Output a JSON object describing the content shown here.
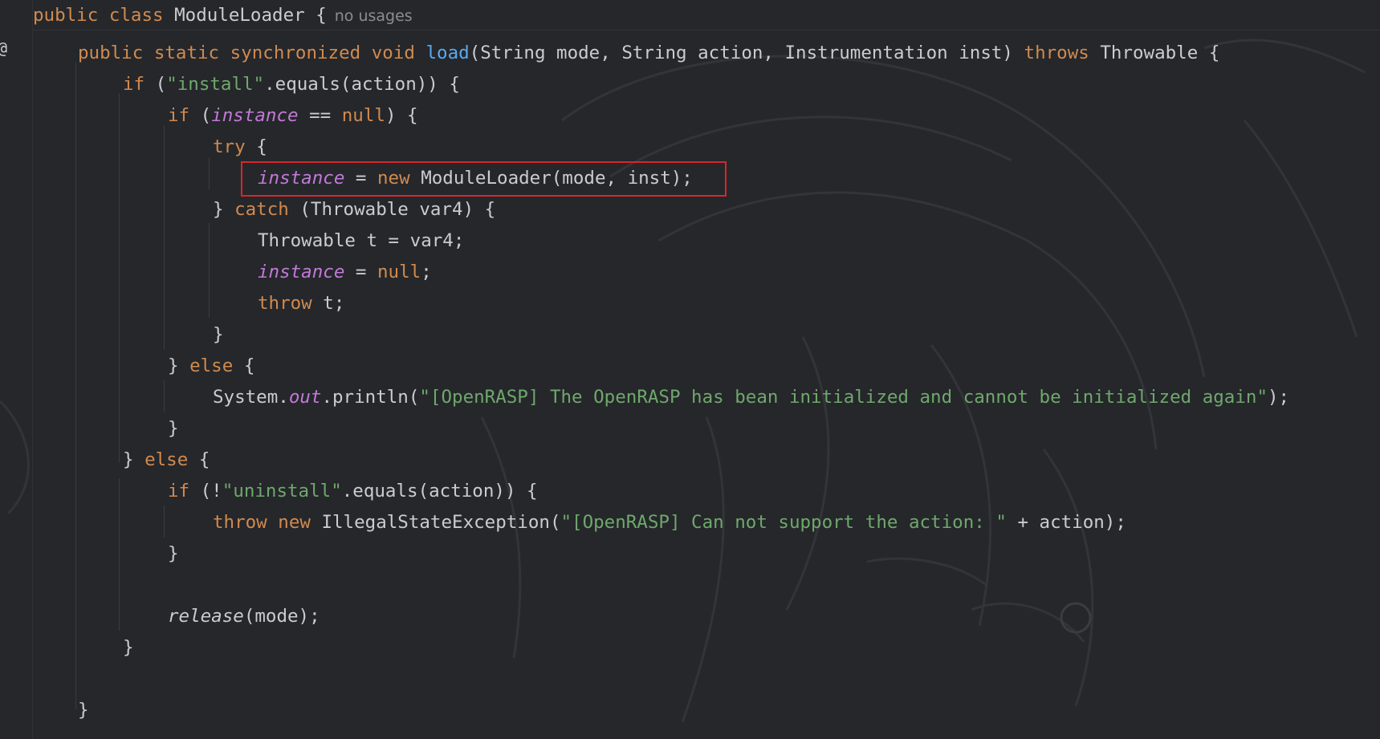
{
  "editor": {
    "class_header": {
      "kw_public": "public",
      "kw_class": "class",
      "class_name": "ModuleLoader",
      "brace": "{",
      "usage_hint": "no usages"
    },
    "gutter_icon": "@",
    "highlight_color": "#d9262b",
    "lines": {
      "l1": {
        "mods": "public static synchronized void",
        "method": "load",
        "params": "(String mode, String action, Instrumentation inst)",
        "throws": "throws",
        "tail": "Throwable {"
      },
      "l2": {
        "kw": "if",
        "open": "(",
        "str": "\"install\"",
        "rest": ".equals(action)) {"
      },
      "l3": {
        "kw": "if",
        "open": "(",
        "field": "instance",
        "op": "==",
        "null": "null",
        "rest": ") {"
      },
      "l4": {
        "kw": "try",
        "rest": "{"
      },
      "l5": {
        "field": "instance",
        "eq": "=",
        "kw": "new",
        "rest": "ModuleLoader(mode, inst);"
      },
      "l6": {
        "open": "}",
        "kw": "catch",
        "rest": "(Throwable var4) {"
      },
      "l7": {
        "text": "Throwable t = var4;"
      },
      "l8": {
        "field": "instance",
        "eq": "=",
        "null": "null",
        "semi": ";"
      },
      "l9": {
        "kw": "throw",
        "rest": "t;"
      },
      "l10": {
        "text": "}"
      },
      "l11": {
        "open": "}",
        "kw": "else",
        "rest": "{"
      },
      "l12": {
        "pre": "System.",
        "field": "out",
        "call": ".println(",
        "str": "\"[OpenRASP] The OpenRASP has bean initialized and cannot be initialized again\"",
        "rest": ");"
      },
      "l13": {
        "text": "}"
      },
      "l14": {
        "open": "}",
        "kw": "else",
        "rest": "{"
      },
      "l15": {
        "kw": "if",
        "open": "(!",
        "str": "\"uninstall\"",
        "rest": ".equals(action)) {"
      },
      "l16": {
        "kw_throw": "throw",
        "kw_new": "new",
        "cls": "IllegalStateException(",
        "str": "\"[OpenRASP] Can not support the action: \"",
        "rest": "+ action);"
      },
      "l17": {
        "text": "}"
      },
      "l18": {
        "fn": "release",
        "rest": "(mode);"
      },
      "l19": {
        "text": "}"
      },
      "l20": {
        "text": "}"
      }
    }
  }
}
